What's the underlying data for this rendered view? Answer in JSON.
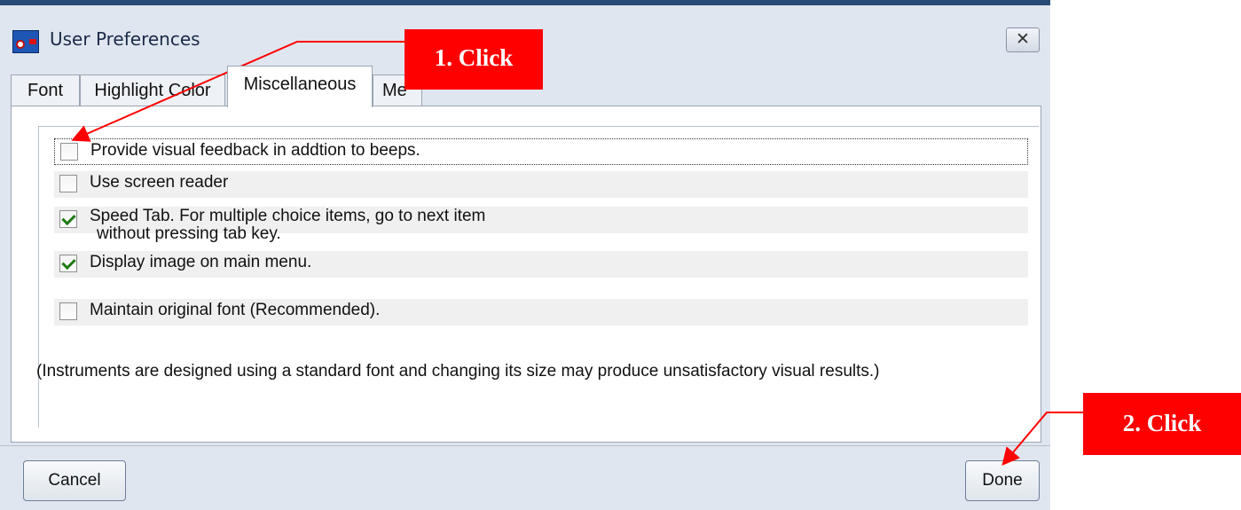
{
  "window": {
    "title": "User Preferences",
    "close_glyph": "✕"
  },
  "tabs": [
    {
      "label": "Font",
      "active": false
    },
    {
      "label": "Highlight Color",
      "active": false
    },
    {
      "label": "Miscellaneous",
      "active": true
    },
    {
      "label": "Me",
      "active": false
    }
  ],
  "options": [
    {
      "label": "Provide visual feedback in addtion to beeps.",
      "checked": false
    },
    {
      "label": "Use screen reader",
      "checked": false
    },
    {
      "label": "Speed Tab. For multiple choice items, go to next item",
      "label_line2": "without pressing tab key.",
      "checked": true
    },
    {
      "label": "Display image on main menu.",
      "checked": true
    },
    {
      "label": "Maintain original font (Recommended).",
      "checked": false
    }
  ],
  "note": "(Instruments are designed using a standard font and changing its size may produce unsatisfactory visual results.)",
  "buttons": {
    "cancel": "Cancel",
    "done": "Done"
  },
  "annotations": {
    "step1": "1. Click",
    "step2": "2. Click",
    "color": "#ff0000"
  }
}
